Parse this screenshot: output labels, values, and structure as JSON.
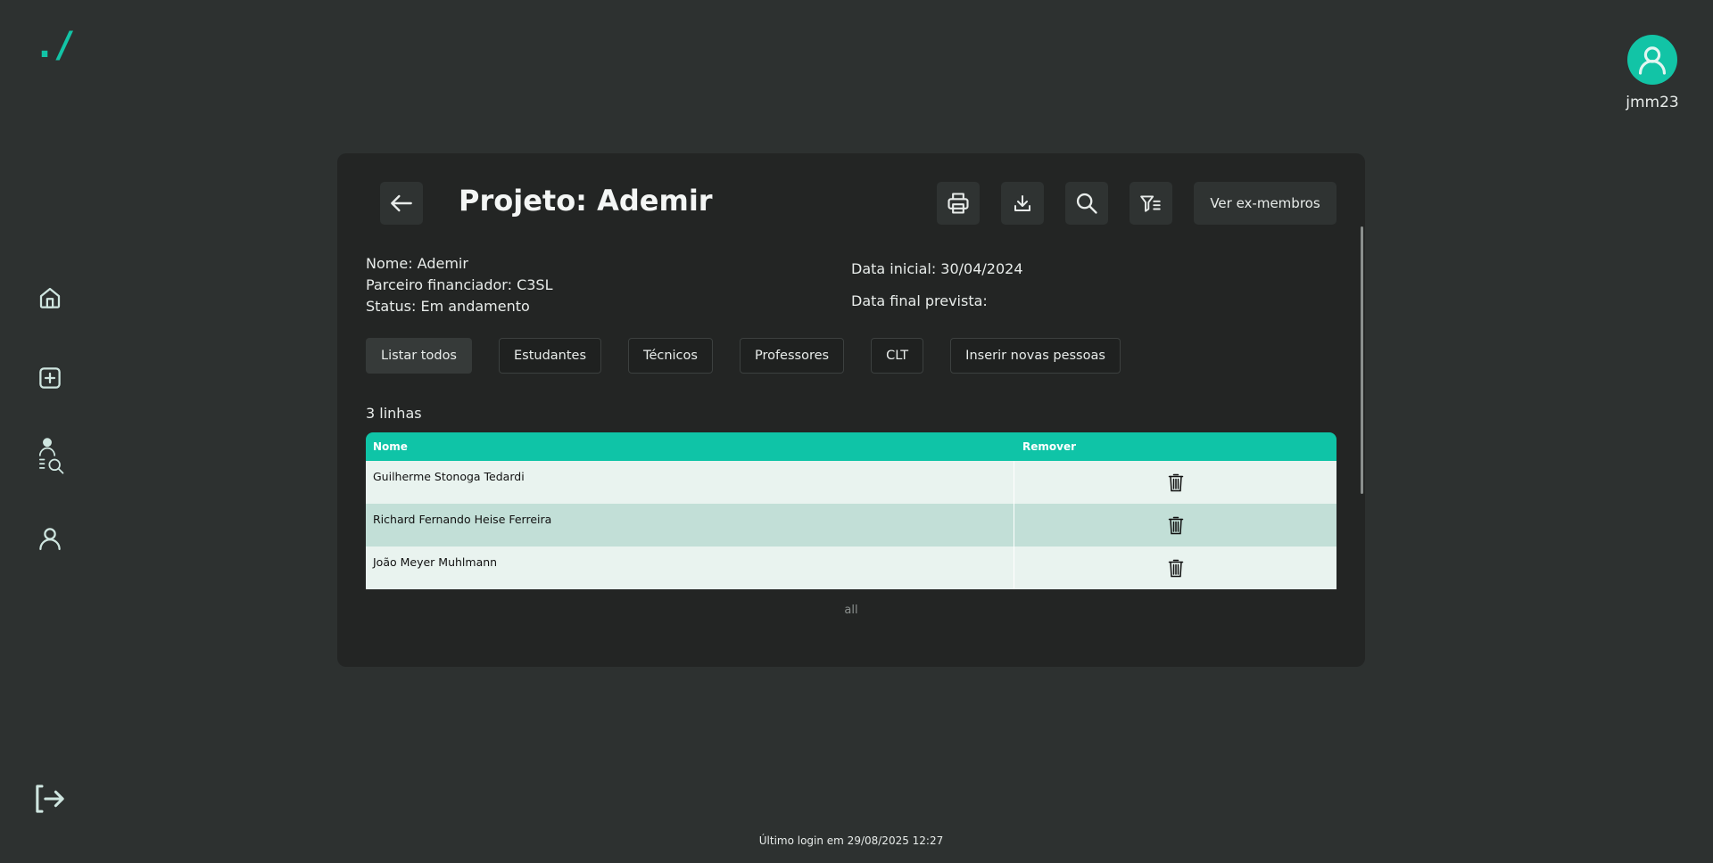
{
  "app": {
    "logo_text": "./",
    "accent": "#12c4a6"
  },
  "sidebar": {
    "items": [
      {
        "icon": "home-icon"
      },
      {
        "icon": "plus-square-icon"
      },
      {
        "icon": "user-search-icon"
      },
      {
        "icon": "user-icon"
      }
    ],
    "logout_icon": "logout-icon"
  },
  "user": {
    "username": "jmm23"
  },
  "project": {
    "title": "Projeto: Ademir",
    "name": "Nome: Ademir",
    "partner": "Parceiro financiador: C3SL",
    "status": "Status: Em andamento",
    "start_date": "Data inicial: 30/04/2024",
    "end_date": "Data final prevista:"
  },
  "toolbar": {
    "icons": [
      "back-arrow-icon",
      "print-icon",
      "download-icon",
      "search-icon",
      "filter-icon"
    ],
    "ex_members_label": "Ver ex-membros"
  },
  "filters": [
    {
      "label": "Listar todos",
      "active": true
    },
    {
      "label": "Estudantes"
    },
    {
      "label": "Técnicos"
    },
    {
      "label": "Professores"
    },
    {
      "label": "CLT"
    },
    {
      "label": "Inserir novas pessoas"
    }
  ],
  "table": {
    "row_count": "3 linhas",
    "columns": [
      "Nome",
      "Remover"
    ],
    "rows": [
      {
        "name": "Guilherme Stonoga Tedardi"
      },
      {
        "name": "Richard Fernando Heise Ferreira"
      },
      {
        "name": "João Meyer Muhlmann"
      }
    ],
    "header_color": "#0fc4a7"
  },
  "pager": {
    "label": "all"
  },
  "footer": {
    "last_login": "Último login em 29/08/2025 12:27"
  }
}
